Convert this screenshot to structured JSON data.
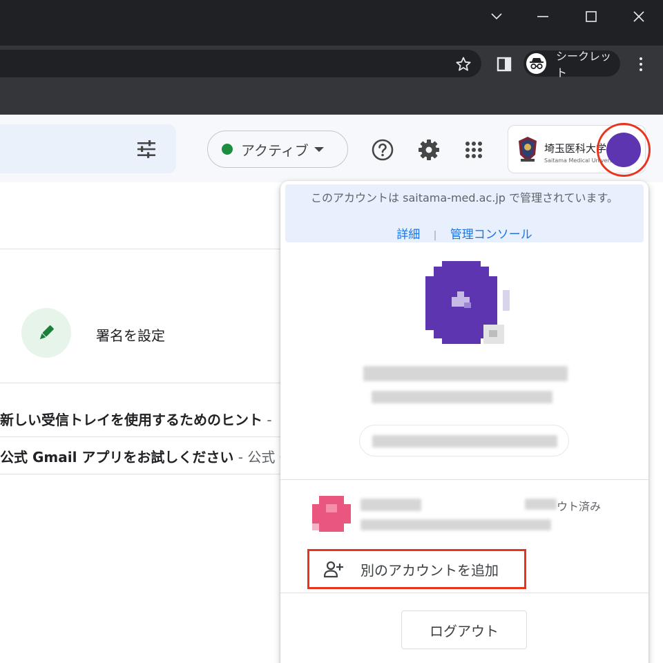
{
  "browser": {
    "incognito_label": "シークレット"
  },
  "header": {
    "status_label": "アクティブ",
    "org": {
      "name": "埼玉医科大学",
      "subtitle": "Saitama Medical University"
    }
  },
  "content": {
    "signature_label": "署名を設定",
    "mails": [
      {
        "subject": "新しい受信トレイを使用するためのヒント",
        "snippet": " - "
      },
      {
        "subject": "公式 Gmail アプリをお試しください",
        "snippet": " - 公式 G"
      }
    ]
  },
  "account_popup": {
    "managed_text": "このアカウントは saitama-med.ac.jp で管理されています。",
    "details_link": "詳細",
    "separator": "|",
    "admin_console_link": "管理コンソール",
    "other_account_status": "ウト済み",
    "add_account_label": "別のアカウントを追加",
    "logout_label": "ログアウト"
  },
  "colors": {
    "avatar": "#5e35b1",
    "highlight": "#e8341c",
    "active": "#1e8e3e",
    "link": "#1a73e8"
  }
}
